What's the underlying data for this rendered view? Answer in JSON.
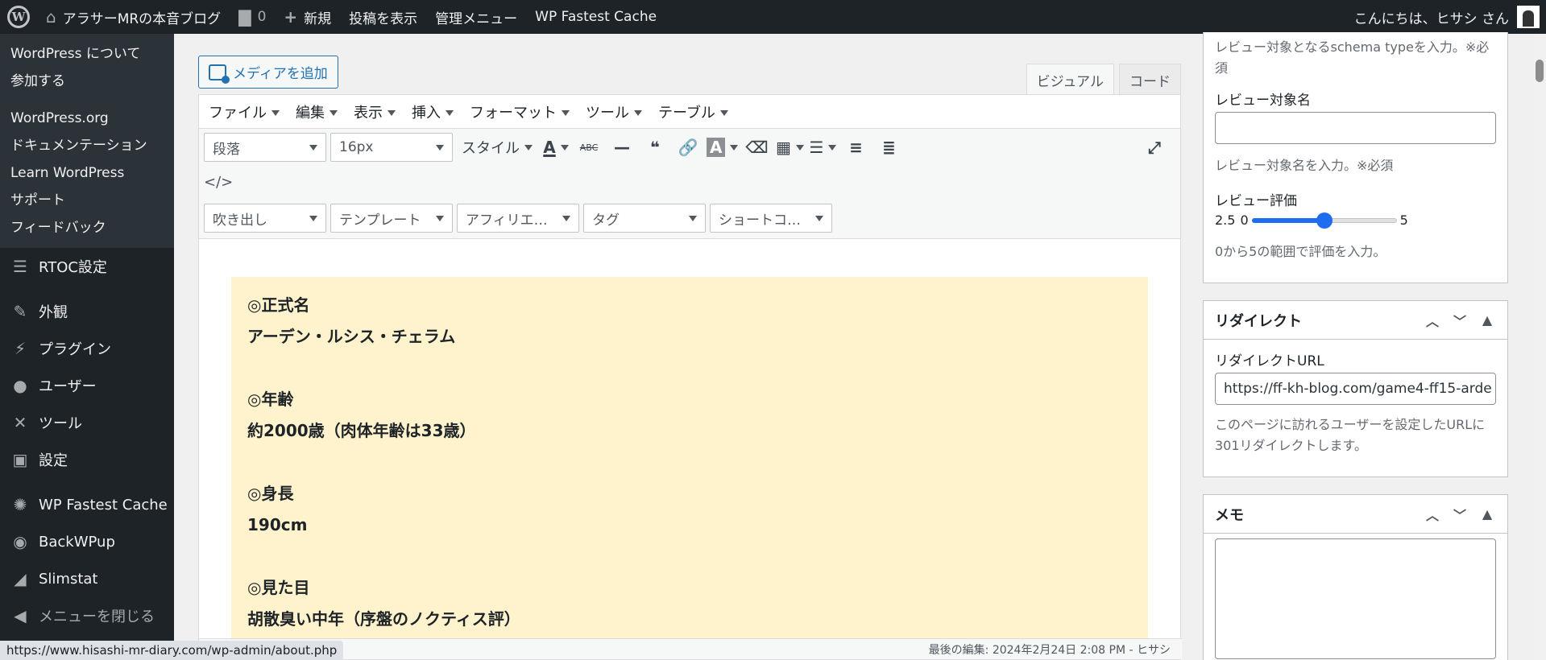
{
  "adminbar": {
    "site_name": "アラサーMRの本音ブログ",
    "comments_count": "0",
    "new_label": "新規",
    "view_posts": "投稿を表示",
    "admin_menu": "管理メニュー",
    "cache": "WP Fastest Cache",
    "greeting": "こんにちは、ヒサシ さん"
  },
  "sidebar": {
    "submenu": [
      "WordPress について",
      "参加する",
      "WordPress.org",
      "ドキュメンテーション",
      "Learn WordPress",
      "サポート",
      "フィードバック"
    ],
    "items": [
      {
        "label": "RTOC設定",
        "icon": "list-icon"
      },
      {
        "label": "外観",
        "icon": "brush-icon"
      },
      {
        "label": "プラグイン",
        "icon": "plugin-icon"
      },
      {
        "label": "ユーザー",
        "icon": "user-icon"
      },
      {
        "label": "ツール",
        "icon": "wrench-icon"
      },
      {
        "label": "設定",
        "icon": "settings-icon"
      },
      {
        "label": "WP Fastest Cache",
        "icon": "cheetah-icon"
      },
      {
        "label": "BackWPup",
        "icon": "backup-icon"
      },
      {
        "label": "Slimstat",
        "icon": "chart-icon"
      },
      {
        "label": "メニューを閉じる",
        "icon": "collapse-icon"
      }
    ]
  },
  "editor": {
    "add_media": "メディアを追加",
    "tab_visual": "ビジュアル",
    "tab_code": "コード",
    "menubar": [
      "ファイル",
      "編集",
      "表示",
      "挿入",
      "フォーマット",
      "ツール",
      "テーブル"
    ],
    "format_select": "段落",
    "size_select": "16px",
    "style_label": "スタイル",
    "row3": [
      "吹き出し",
      "テンプレート",
      "アフィリエ…",
      "タグ",
      "ショートコ…"
    ],
    "content": [
      "◎正式名",
      "アーデン・ルシス・チェラム",
      "",
      "◎年齢",
      "約2000歳（肉体年齢は33歳）",
      "",
      "◎身長",
      "190cm",
      "",
      "◎見た目",
      "胡散臭い中年（序盤のノクティス評）"
    ],
    "last_edit": "最後の編集: 2024年2月24日 2:08 PM - ヒサシ"
  },
  "status_url": "https://www.hisashi-mr-diary.com/wp-admin/about.php",
  "review": {
    "schema_help": "レビュー対象となるschema typeを入力。※必須",
    "name_label": "レビュー対象名",
    "name_value": "",
    "name_help": "レビュー対象名を入力。※必須",
    "rating_label": "レビュー評価",
    "rating_value": "2.5",
    "rating_min": "0",
    "rating_max": "5",
    "rating_fraction": 0.5,
    "rating_help": "0から5の範囲で評価を入力。"
  },
  "redirect": {
    "title": "リダイレクト",
    "url_label": "リダイレクトURL",
    "url_value": "https://ff-kh-blog.com/game4-ff15-arde",
    "help": "このページに訪れるユーザーを設定したURLに301リダイレクトします。"
  },
  "memo": {
    "title": "メモ"
  }
}
